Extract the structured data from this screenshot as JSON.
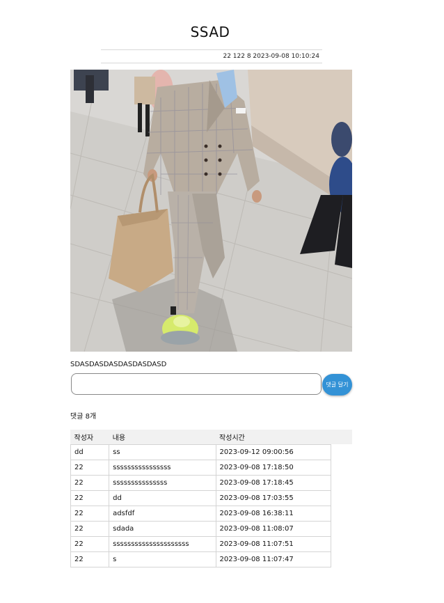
{
  "post": {
    "title": "SSAD",
    "meta": "22 122 8 2023-09-08 10:10:24",
    "body": "SDASDASDASDASDASDASD",
    "image_alt": "street fashion photo"
  },
  "comment_form": {
    "input_value": "",
    "submit_label": "댓글 달기"
  },
  "comments": {
    "count_label": "댓글 8개",
    "headers": [
      "작성자",
      "내용",
      "작성시간"
    ],
    "rows": [
      {
        "author": "dd",
        "content": "ss",
        "time": "2023-09-12 09:00:56"
      },
      {
        "author": "22",
        "content": "ssssssssssssssss",
        "time": "2023-09-08 17:18:50"
      },
      {
        "author": "22",
        "content": "sssssssssssssss",
        "time": "2023-09-08 17:18:45"
      },
      {
        "author": "22",
        "content": "dd",
        "time": "2023-09-08 17:03:55"
      },
      {
        "author": "22",
        "content": "adsfdf",
        "time": "2023-09-08 16:38:11"
      },
      {
        "author": "22",
        "content": "sdada",
        "time": "2023-09-08 11:08:07"
      },
      {
        "author": "22",
        "content": "sssssssssssssssssssss",
        "time": "2023-09-08 11:07:51"
      },
      {
        "author": "22",
        "content": "s",
        "time": "2023-09-08 11:07:47"
      }
    ]
  },
  "colors": {
    "button": "#3392d6",
    "header_bg": "#f1f1f1",
    "border": "#d4d4d4"
  }
}
